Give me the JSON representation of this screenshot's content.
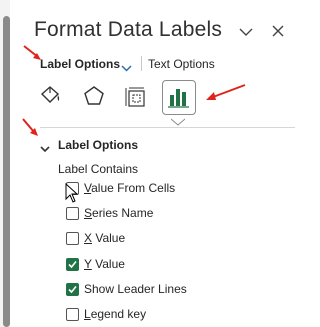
{
  "pane": {
    "title": "Format Data Labels"
  },
  "tabs": {
    "label_options": "Label Options",
    "text_options": "Text Options"
  },
  "toolbar_icons": [
    "fill-line-icon",
    "effects-pentagon-icon",
    "size-properties-icon",
    "label-options-bar-chart-icon"
  ],
  "section": {
    "title": "Label Options",
    "subheading": "Label Contains",
    "items": [
      {
        "label": "Value From Cells",
        "checked": false
      },
      {
        "label": "Series Name",
        "checked": false
      },
      {
        "label": "X Value",
        "checked": false
      },
      {
        "label": "Y Value",
        "checked": true
      },
      {
        "label": "Show Leader Lines",
        "checked": true
      },
      {
        "label": "Legend key",
        "checked": false
      }
    ]
  },
  "colors": {
    "annotation_arrow": "#e0241b",
    "checkbox_checked": "#217346"
  }
}
